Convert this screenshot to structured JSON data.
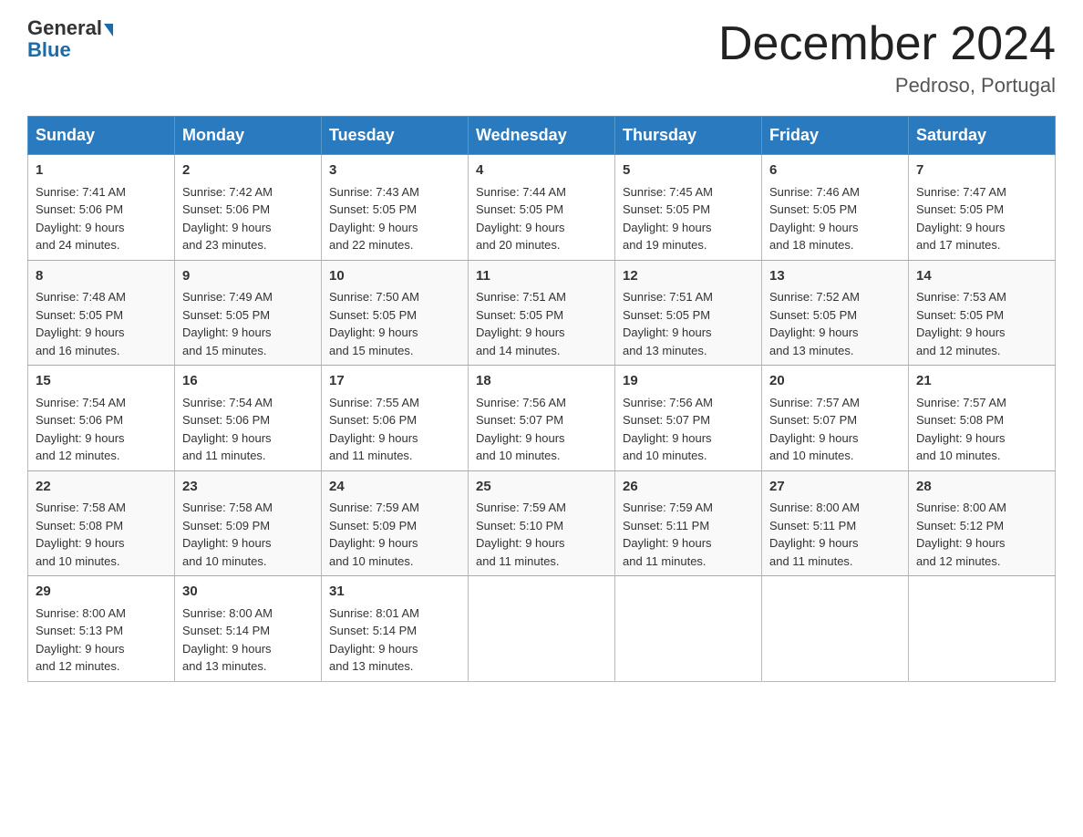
{
  "logo": {
    "general": "General",
    "blue": "Blue"
  },
  "title": "December 2024",
  "location": "Pedroso, Portugal",
  "headers": [
    "Sunday",
    "Monday",
    "Tuesday",
    "Wednesday",
    "Thursday",
    "Friday",
    "Saturday"
  ],
  "weeks": [
    [
      {
        "day": "1",
        "sunrise": "7:41 AM",
        "sunset": "5:06 PM",
        "daylight": "9 hours and 24 minutes."
      },
      {
        "day": "2",
        "sunrise": "7:42 AM",
        "sunset": "5:06 PM",
        "daylight": "9 hours and 23 minutes."
      },
      {
        "day": "3",
        "sunrise": "7:43 AM",
        "sunset": "5:05 PM",
        "daylight": "9 hours and 22 minutes."
      },
      {
        "day": "4",
        "sunrise": "7:44 AM",
        "sunset": "5:05 PM",
        "daylight": "9 hours and 20 minutes."
      },
      {
        "day": "5",
        "sunrise": "7:45 AM",
        "sunset": "5:05 PM",
        "daylight": "9 hours and 19 minutes."
      },
      {
        "day": "6",
        "sunrise": "7:46 AM",
        "sunset": "5:05 PM",
        "daylight": "9 hours and 18 minutes."
      },
      {
        "day": "7",
        "sunrise": "7:47 AM",
        "sunset": "5:05 PM",
        "daylight": "9 hours and 17 minutes."
      }
    ],
    [
      {
        "day": "8",
        "sunrise": "7:48 AM",
        "sunset": "5:05 PM",
        "daylight": "9 hours and 16 minutes."
      },
      {
        "day": "9",
        "sunrise": "7:49 AM",
        "sunset": "5:05 PM",
        "daylight": "9 hours and 15 minutes."
      },
      {
        "day": "10",
        "sunrise": "7:50 AM",
        "sunset": "5:05 PM",
        "daylight": "9 hours and 15 minutes."
      },
      {
        "day": "11",
        "sunrise": "7:51 AM",
        "sunset": "5:05 PM",
        "daylight": "9 hours and 14 minutes."
      },
      {
        "day": "12",
        "sunrise": "7:51 AM",
        "sunset": "5:05 PM",
        "daylight": "9 hours and 13 minutes."
      },
      {
        "day": "13",
        "sunrise": "7:52 AM",
        "sunset": "5:05 PM",
        "daylight": "9 hours and 13 minutes."
      },
      {
        "day": "14",
        "sunrise": "7:53 AM",
        "sunset": "5:05 PM",
        "daylight": "9 hours and 12 minutes."
      }
    ],
    [
      {
        "day": "15",
        "sunrise": "7:54 AM",
        "sunset": "5:06 PM",
        "daylight": "9 hours and 12 minutes."
      },
      {
        "day": "16",
        "sunrise": "7:54 AM",
        "sunset": "5:06 PM",
        "daylight": "9 hours and 11 minutes."
      },
      {
        "day": "17",
        "sunrise": "7:55 AM",
        "sunset": "5:06 PM",
        "daylight": "9 hours and 11 minutes."
      },
      {
        "day": "18",
        "sunrise": "7:56 AM",
        "sunset": "5:07 PM",
        "daylight": "9 hours and 10 minutes."
      },
      {
        "day": "19",
        "sunrise": "7:56 AM",
        "sunset": "5:07 PM",
        "daylight": "9 hours and 10 minutes."
      },
      {
        "day": "20",
        "sunrise": "7:57 AM",
        "sunset": "5:07 PM",
        "daylight": "9 hours and 10 minutes."
      },
      {
        "day": "21",
        "sunrise": "7:57 AM",
        "sunset": "5:08 PM",
        "daylight": "9 hours and 10 minutes."
      }
    ],
    [
      {
        "day": "22",
        "sunrise": "7:58 AM",
        "sunset": "5:08 PM",
        "daylight": "9 hours and 10 minutes."
      },
      {
        "day": "23",
        "sunrise": "7:58 AM",
        "sunset": "5:09 PM",
        "daylight": "9 hours and 10 minutes."
      },
      {
        "day": "24",
        "sunrise": "7:59 AM",
        "sunset": "5:09 PM",
        "daylight": "9 hours and 10 minutes."
      },
      {
        "day": "25",
        "sunrise": "7:59 AM",
        "sunset": "5:10 PM",
        "daylight": "9 hours and 11 minutes."
      },
      {
        "day": "26",
        "sunrise": "7:59 AM",
        "sunset": "5:11 PM",
        "daylight": "9 hours and 11 minutes."
      },
      {
        "day": "27",
        "sunrise": "8:00 AM",
        "sunset": "5:11 PM",
        "daylight": "9 hours and 11 minutes."
      },
      {
        "day": "28",
        "sunrise": "8:00 AM",
        "sunset": "5:12 PM",
        "daylight": "9 hours and 12 minutes."
      }
    ],
    [
      {
        "day": "29",
        "sunrise": "8:00 AM",
        "sunset": "5:13 PM",
        "daylight": "9 hours and 12 minutes."
      },
      {
        "day": "30",
        "sunrise": "8:00 AM",
        "sunset": "5:14 PM",
        "daylight": "9 hours and 13 minutes."
      },
      {
        "day": "31",
        "sunrise": "8:01 AM",
        "sunset": "5:14 PM",
        "daylight": "9 hours and 13 minutes."
      },
      null,
      null,
      null,
      null
    ]
  ],
  "labels": {
    "sunrise": "Sunrise:",
    "sunset": "Sunset:",
    "daylight": "Daylight:"
  }
}
